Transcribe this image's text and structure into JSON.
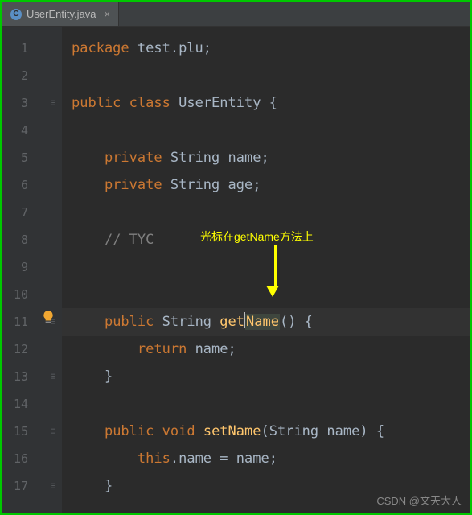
{
  "tab": {
    "icon_letter": "C",
    "filename": "UserEntity.java",
    "close_glyph": "×"
  },
  "gutter": {
    "lines": [
      "1",
      "2",
      "3",
      "4",
      "5",
      "6",
      "7",
      "8",
      "9",
      "10",
      "11",
      "12",
      "13",
      "14",
      "15",
      "16",
      "17"
    ]
  },
  "code": {
    "l1": {
      "kw": "package",
      "rest": " test.plu;"
    },
    "l3": {
      "kw1": "public",
      "kw2": "class",
      "cls": "UserEntity",
      "brace": " {"
    },
    "l5": {
      "kw": "private",
      "type": "String",
      "name": "name",
      "semi": ";"
    },
    "l6": {
      "kw": "private",
      "type": "String",
      "name": "age",
      "semi": ";"
    },
    "l8": {
      "comment": "// TYC"
    },
    "l11": {
      "kw": "public",
      "type": "String",
      "m1": "get",
      "m2": "Name",
      "rest": "() {"
    },
    "l12": {
      "kw": "return",
      "name": "name",
      "semi": ";"
    },
    "l13": {
      "brace": "}"
    },
    "l15": {
      "kw1": "public",
      "kw2": "void",
      "method": "setName",
      "paren1": "(",
      "ptype": "String",
      "pname": " name",
      "paren2": ") {"
    },
    "l16": {
      "kw": "this",
      "dot": ".",
      "field": "name",
      "eq": " = ",
      "param": "name",
      "semi": ";"
    },
    "l17": {
      "brace": "}"
    }
  },
  "annotation": {
    "text": "光标在getName方法上"
  },
  "watermark": "CSDN @文天大人",
  "fold": {
    "down": "⊟",
    "up": "⊟"
  }
}
